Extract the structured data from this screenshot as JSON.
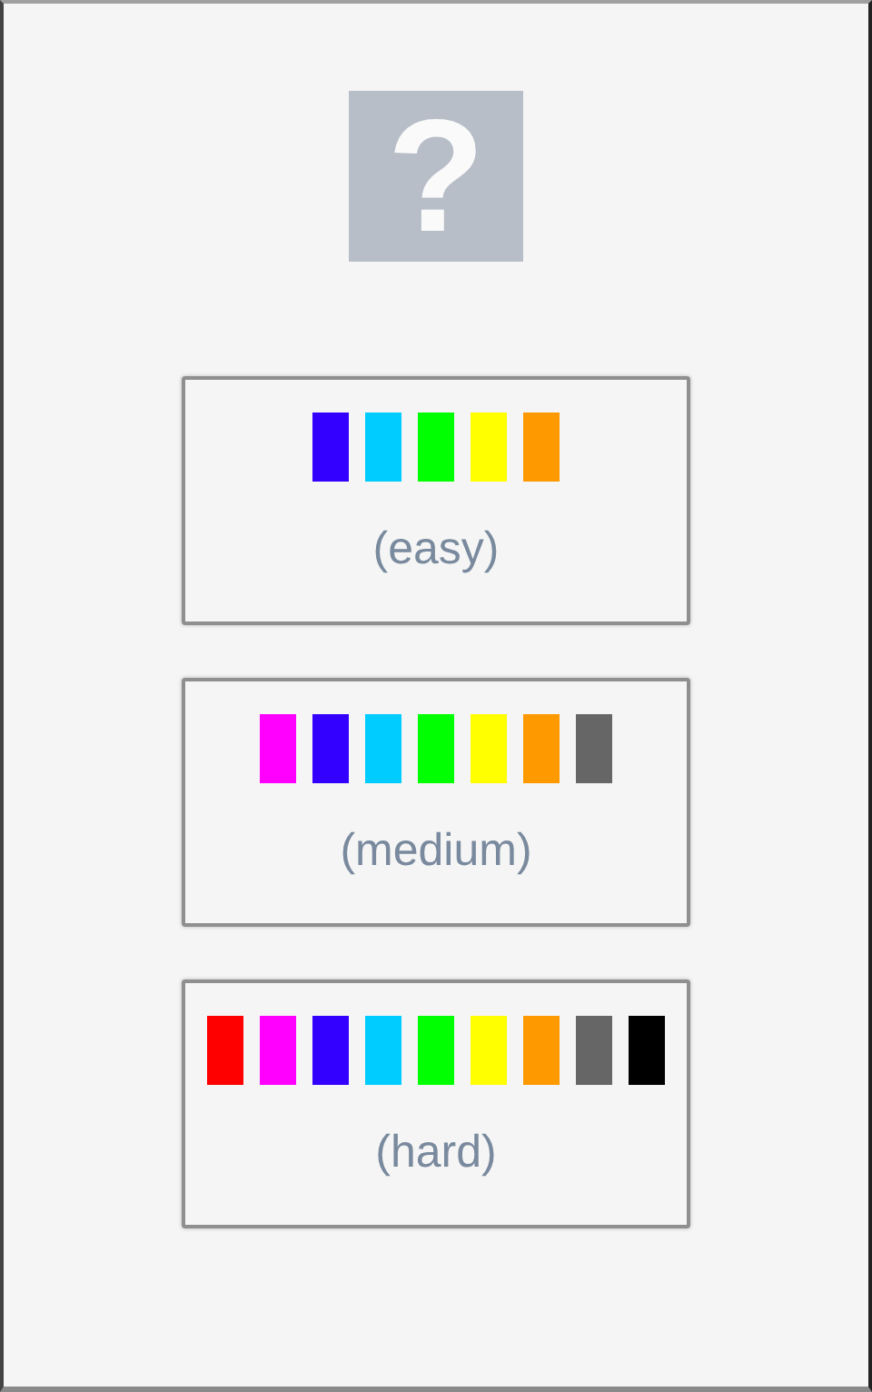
{
  "help_tile": {
    "symbol": "?"
  },
  "levels": [
    {
      "label": "(easy)",
      "colors": [
        {
          "color": "#3300ff"
        },
        {
          "color": "#00ccff"
        },
        {
          "color": "#00ff00"
        },
        {
          "color": "#ffff00"
        },
        {
          "color": "#ff9900"
        }
      ]
    },
    {
      "label": "(medium)",
      "colors": [
        {
          "color": "#ff00ff"
        },
        {
          "color": "#3300ff"
        },
        {
          "color": "#00ccff"
        },
        {
          "color": "#00ff00"
        },
        {
          "color": "#ffff00"
        },
        {
          "color": "#ff9900"
        },
        {
          "color": "#666666"
        }
      ]
    },
    {
      "label": "(hard)",
      "colors": [
        {
          "color": "#ff0000"
        },
        {
          "color": "#ff00ff"
        },
        {
          "color": "#3300ff"
        },
        {
          "color": "#00ccff"
        },
        {
          "color": "#00ff00"
        },
        {
          "color": "#ffff00"
        },
        {
          "color": "#ff9900"
        },
        {
          "color": "#666666"
        },
        {
          "color": "#000000"
        }
      ]
    }
  ]
}
